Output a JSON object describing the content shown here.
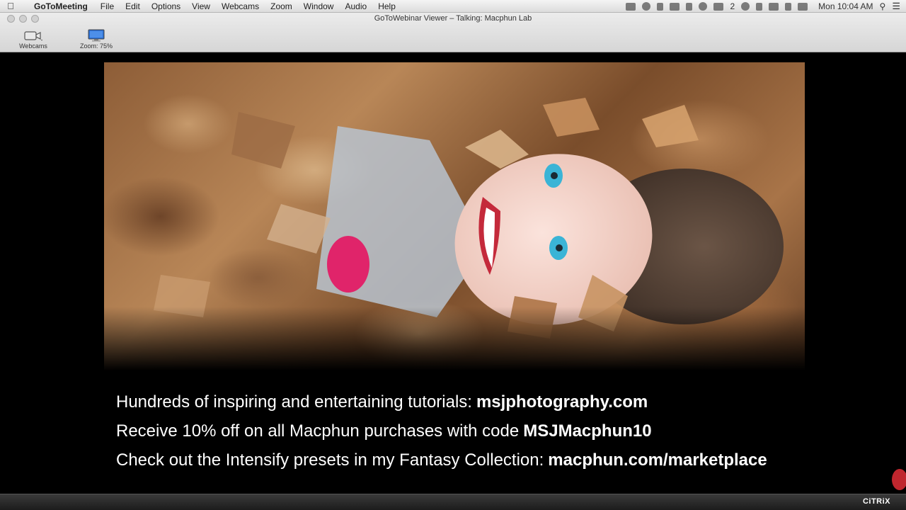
{
  "menubar": {
    "apple_icon": "apple-icon",
    "app_name": "GoToMeeting",
    "items": [
      "File",
      "Edit",
      "Options",
      "View",
      "Webcams",
      "Zoom",
      "Window",
      "Audio",
      "Help"
    ],
    "status_badge": "2",
    "clock": "Mon 10:04 AM"
  },
  "window": {
    "title": "GoToWebinar Viewer – Talking: Macphun  Lab",
    "toolbar": {
      "webcams_label": "Webcams",
      "zoom_label": "Zoom: 75%"
    }
  },
  "presentation": {
    "photo_icon": "photo-girl-in-leaves",
    "lines": [
      {
        "text": "Hundreds of inspiring and entertaining tutorials:",
        "bold": "msjphotography.com"
      },
      {
        "text": "Receive 10% off on all Macphun purchases with code",
        "bold": "MSJMacphun10"
      },
      {
        "text": "Check out the Intensify presets in my Fantasy Collection:",
        "bold": "macphun.com/marketplace"
      }
    ]
  },
  "footer": {
    "brand": "CiTRiX"
  },
  "colors": {
    "stage_background": "#000000",
    "indicator": "#c0262e"
  }
}
